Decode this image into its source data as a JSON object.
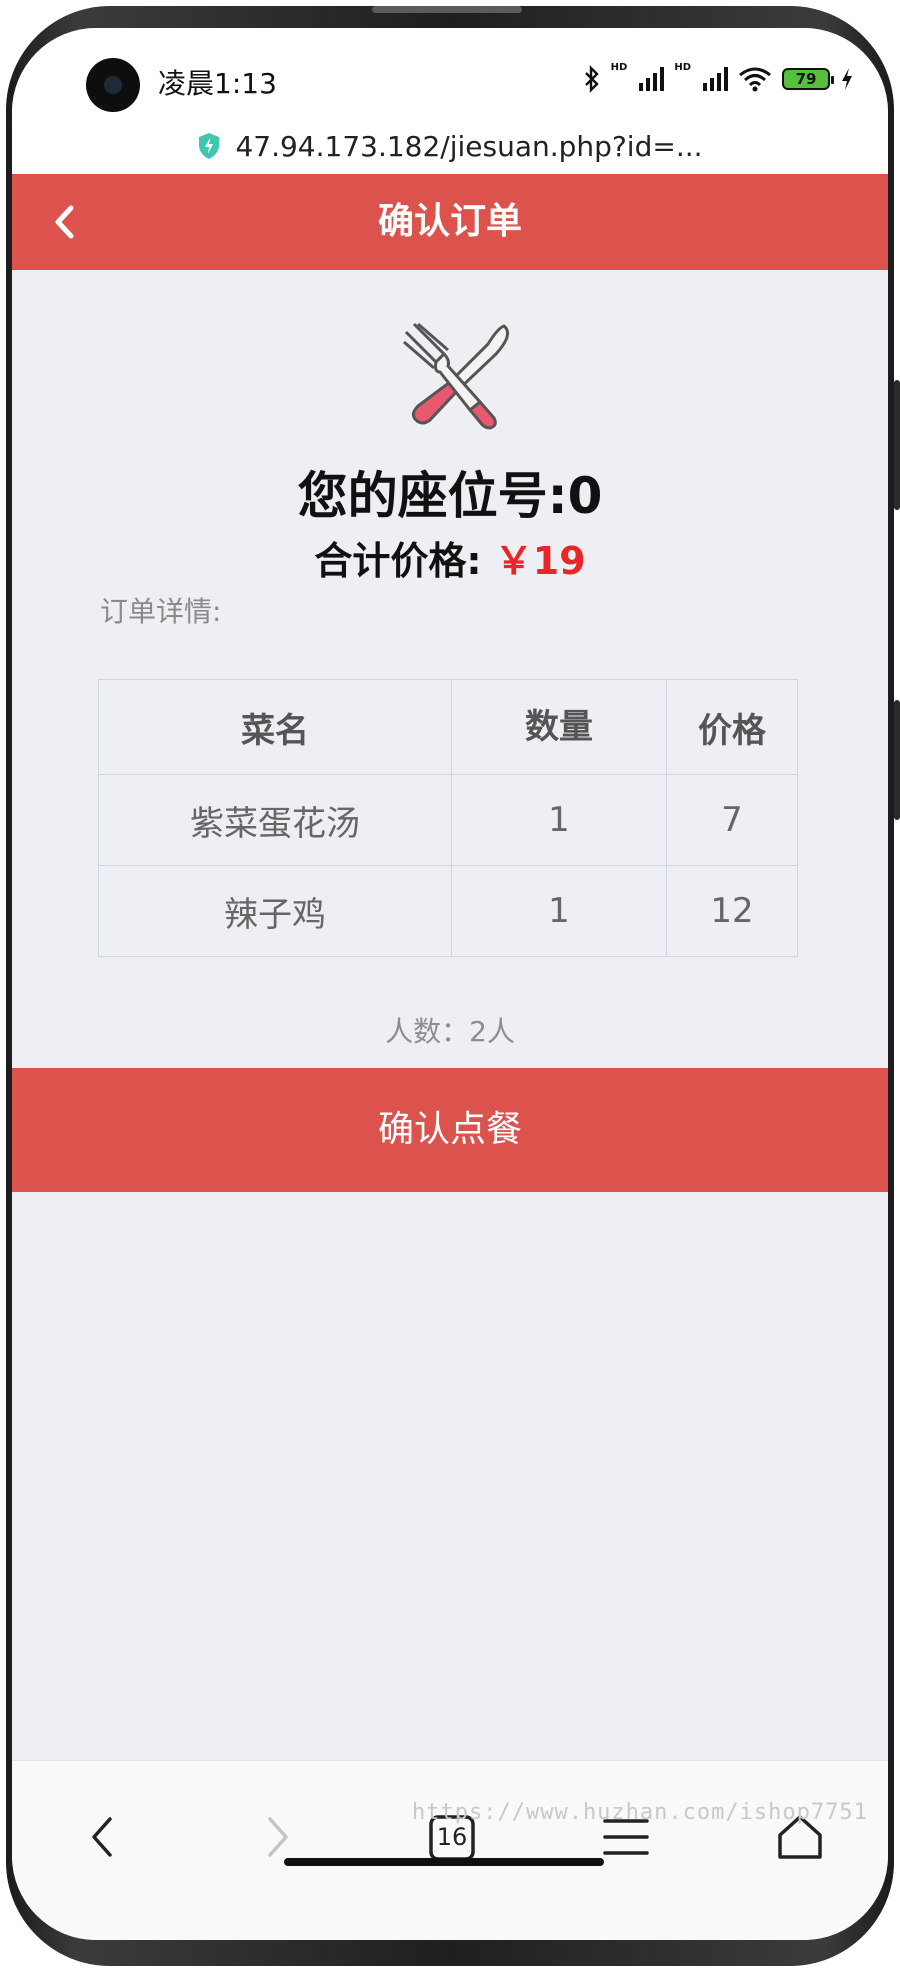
{
  "status_bar": {
    "time": "凌晨1:13",
    "hd1": "HD",
    "hd2": "HD",
    "battery": "79"
  },
  "url_bar": {
    "url": "47.94.173.182/jiesuan.php?id=..."
  },
  "header": {
    "title": "确认订单",
    "back_icon": "chevron-left-icon"
  },
  "order": {
    "seat_label": "您的座位号:0",
    "total_label": "合计价格:",
    "total_price": "￥19",
    "detail_label": "订单详情:",
    "columns": [
      "菜名",
      "数量",
      "价格"
    ],
    "rows": [
      [
        "紫菜蛋花汤",
        "1",
        "7"
      ],
      [
        "辣子鸡",
        "1",
        "12"
      ]
    ],
    "people": "人数：2人",
    "confirm_label": "确认点餐"
  },
  "bottom_nav": {
    "tab_count": "16",
    "items": [
      "back-icon",
      "forward-icon",
      "tabs-icon",
      "menu-icon",
      "home-icon"
    ]
  },
  "watermark": "https://www.huzhan.com/ishop7751",
  "colors": {
    "accent": "#dc524d",
    "price": "#e82626",
    "background": "#efeef3"
  }
}
